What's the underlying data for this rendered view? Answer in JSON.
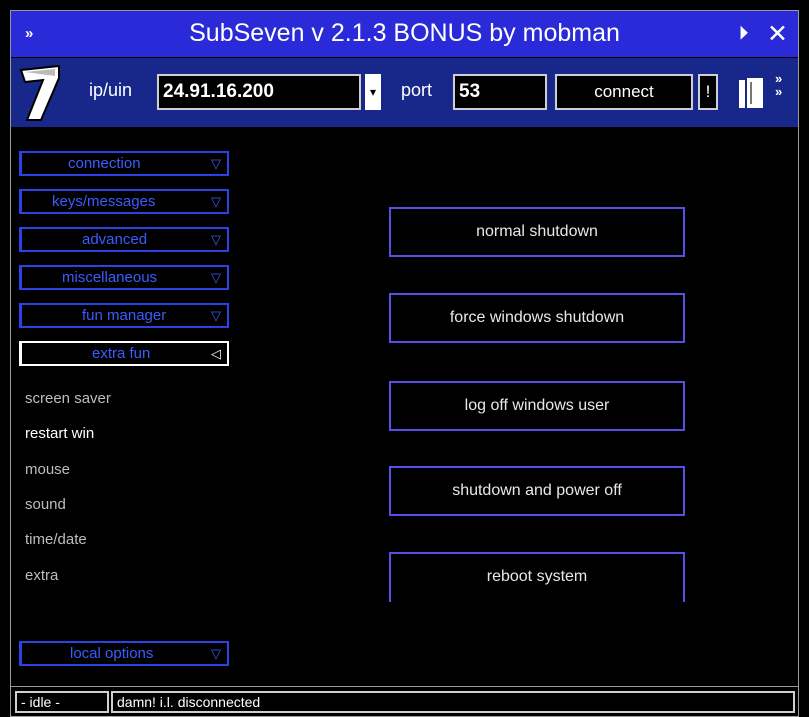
{
  "window": {
    "title": "SubSeven v 2.1.3 BONUS by mobman"
  },
  "toolbar": {
    "ip_label": "ip/uin",
    "ip_value": "24.91.16.200",
    "port_label": "port",
    "port_value": "53",
    "connect_label": "connect",
    "bang_label": "!"
  },
  "sidebar": {
    "menus": [
      {
        "label": "connection",
        "chevron": "▽"
      },
      {
        "label": "keys/messages",
        "chevron": "▽"
      },
      {
        "label": "advanced",
        "chevron": "▽"
      },
      {
        "label": "miscellaneous",
        "chevron": "▽"
      },
      {
        "label": "fun manager",
        "chevron": "▽"
      },
      {
        "label": "extra fun",
        "chevron": "◁"
      }
    ],
    "sub_items": [
      "screen saver",
      "restart win",
      "mouse",
      "sound",
      "time/date",
      "extra"
    ],
    "local_options": {
      "label": "local options",
      "chevron": "▽"
    }
  },
  "actions": [
    "normal shutdown",
    "force windows shutdown",
    "log off windows user",
    "shutdown and power off",
    "reboot system"
  ],
  "status": {
    "idle": "- idle -",
    "message": "damn! i.l. disconnected"
  },
  "colors": {
    "titlebar": "#2a2ad8",
    "toolbar": "#17288a",
    "menu_border": "#2a42e6",
    "action_border": "#5a4ee6"
  }
}
